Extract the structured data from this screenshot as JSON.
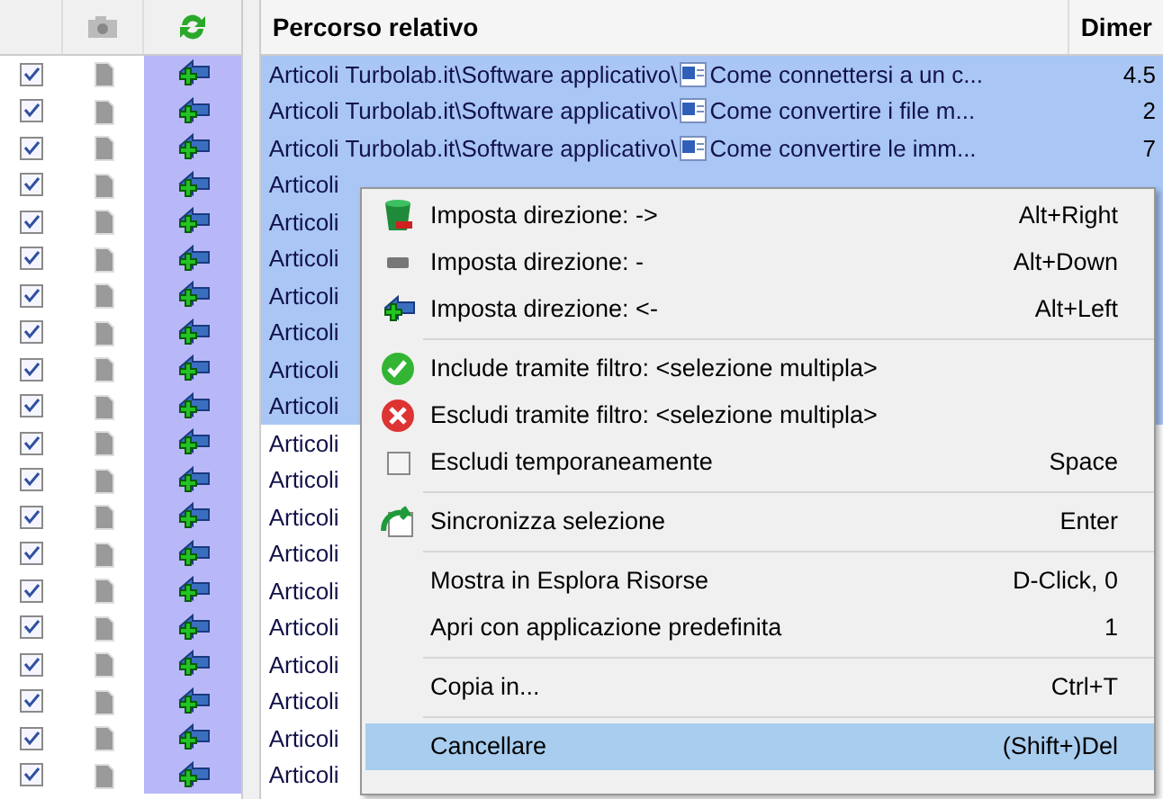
{
  "left_header": {
    "column_3_sync": true
  },
  "table": {
    "columns": [
      "Percorso relativo",
      "Dimer"
    ],
    "rows": [
      {
        "checked": true,
        "selected": true,
        "path": "Articoli Turbolab.it\\Software applicativo\\",
        "name": "Come connettersi a un c...",
        "size": "4.5"
      },
      {
        "checked": true,
        "selected": true,
        "path": "Articoli Turbolab.it\\Software applicativo\\",
        "name": "Come convertire i file m...",
        "size": "2"
      },
      {
        "checked": true,
        "selected": true,
        "path": "Articoli Turbolab.it\\Software applicativo\\",
        "name": "Come convertire le imm...",
        "size": "7"
      },
      {
        "checked": true,
        "selected": true,
        "path": "Articoli"
      },
      {
        "checked": true,
        "selected": true,
        "path": "Articoli"
      },
      {
        "checked": true,
        "selected": true,
        "path": "Articoli"
      },
      {
        "checked": true,
        "selected": true,
        "path": "Articoli"
      },
      {
        "checked": true,
        "selected": true,
        "path": "Articoli"
      },
      {
        "checked": true,
        "selected": true,
        "path": "Articoli"
      },
      {
        "checked": true,
        "selected": true,
        "path": "Articoli"
      },
      {
        "checked": true,
        "selected": false,
        "path": "Articoli"
      },
      {
        "checked": true,
        "selected": false,
        "path": "Articoli"
      },
      {
        "checked": true,
        "selected": false,
        "path": "Articoli"
      },
      {
        "checked": true,
        "selected": false,
        "path": "Articoli"
      },
      {
        "checked": true,
        "selected": false,
        "path": "Articoli"
      },
      {
        "checked": true,
        "selected": false,
        "path": "Articoli"
      },
      {
        "checked": true,
        "selected": false,
        "path": "Articoli"
      },
      {
        "checked": true,
        "selected": false,
        "path": "Articoli"
      },
      {
        "checked": true,
        "selected": false,
        "path": "Articoli"
      },
      {
        "checked": true,
        "selected": false,
        "path": "Articoli"
      }
    ]
  },
  "context_menu": {
    "groups": [
      [
        {
          "kind": "trash",
          "label": "Imposta direzione: ->",
          "shortcut": "Alt+Right",
          "selected": false
        },
        {
          "kind": "minus",
          "label": "Imposta direzione: -",
          "shortcut": "Alt+Down",
          "selected": false
        },
        {
          "kind": "arrow",
          "label": "Imposta direzione: <-",
          "shortcut": "Alt+Left",
          "selected": false
        }
      ],
      [
        {
          "kind": "check",
          "label": "Include tramite filtro: <selezione multipla>",
          "selected": false
        },
        {
          "kind": "cross",
          "label": "Escludi tramite filtro: <selezione multipla>",
          "selected": false
        },
        {
          "kind": "checkbox",
          "label": "Escludi temporaneamente",
          "shortcut": "Space",
          "selected": false
        }
      ],
      [
        {
          "kind": "sync",
          "label": "Sincronizza selezione",
          "shortcut": "Enter",
          "selected": false
        }
      ],
      [
        {
          "kind": "none",
          "label": "Mostra in Esplora Risorse",
          "shortcut": "D-Click, 0",
          "selected": false
        },
        {
          "kind": "none",
          "label": "Apri con applicazione predefinita",
          "shortcut": "1",
          "selected": false
        }
      ],
      [
        {
          "kind": "none",
          "label": "Copia in...",
          "shortcut": "Ctrl+T",
          "selected": false
        }
      ],
      [
        {
          "kind": "none",
          "label": "Cancellare",
          "shortcut": "(Shift+)Del",
          "selected": true
        }
      ]
    ]
  }
}
